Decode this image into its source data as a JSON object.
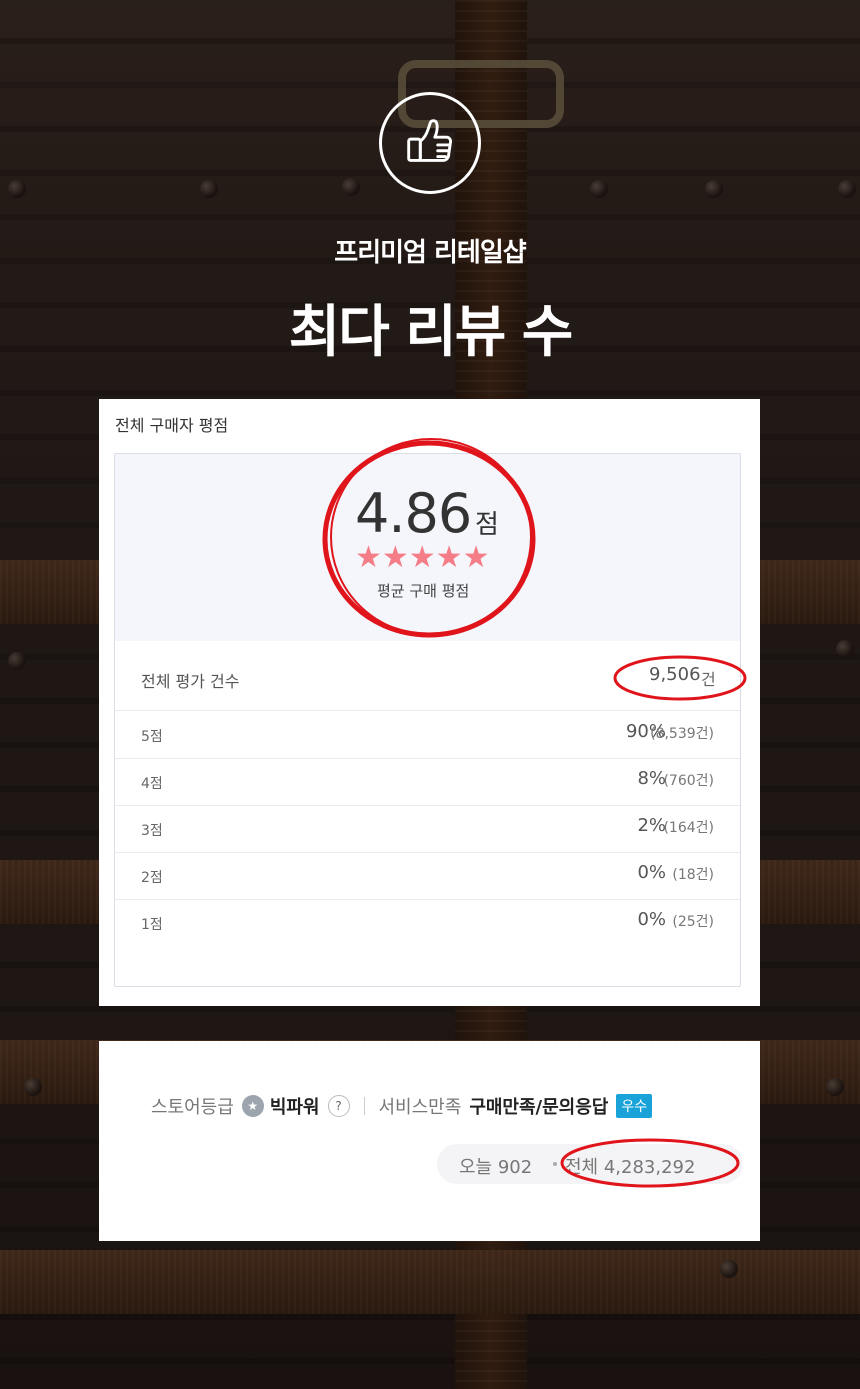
{
  "hero": {
    "subtitle": "프리미엄 리테일샵",
    "title": "최다 리뷰 수",
    "icon": "thumbs-up-icon"
  },
  "rating_card": {
    "title": "전체 구매자 평점",
    "average": "4.86",
    "average_unit": "점",
    "stars": "★★★★★",
    "average_label": "평균 구매 평점",
    "total_label": "전체 평가 건수",
    "total_count": "9,506",
    "total_unit": "건",
    "distribution": [
      {
        "label": "5점",
        "percent": "90%",
        "count": "(8,539건)"
      },
      {
        "label": "4점",
        "percent": "8%",
        "count": "(760건)"
      },
      {
        "label": "3점",
        "percent": "2%",
        "count": "(164건)"
      },
      {
        "label": "2점",
        "percent": "0%",
        "count": "(18건)"
      },
      {
        "label": "1점",
        "percent": "0%",
        "count": "(25건)"
      }
    ]
  },
  "store_card": {
    "store_label": "스토어등급",
    "grade": "빅파워",
    "help": "?",
    "service_label": "서비스만족",
    "service_value": "구매만족/문의응답",
    "badge": "우수",
    "today_visits": "오늘 902",
    "total_visits": "전체 4,283,292"
  },
  "colors": {
    "accent_red": "#e0141b",
    "star_pink": "#f47d87",
    "badge_blue": "#1aa3d8"
  }
}
